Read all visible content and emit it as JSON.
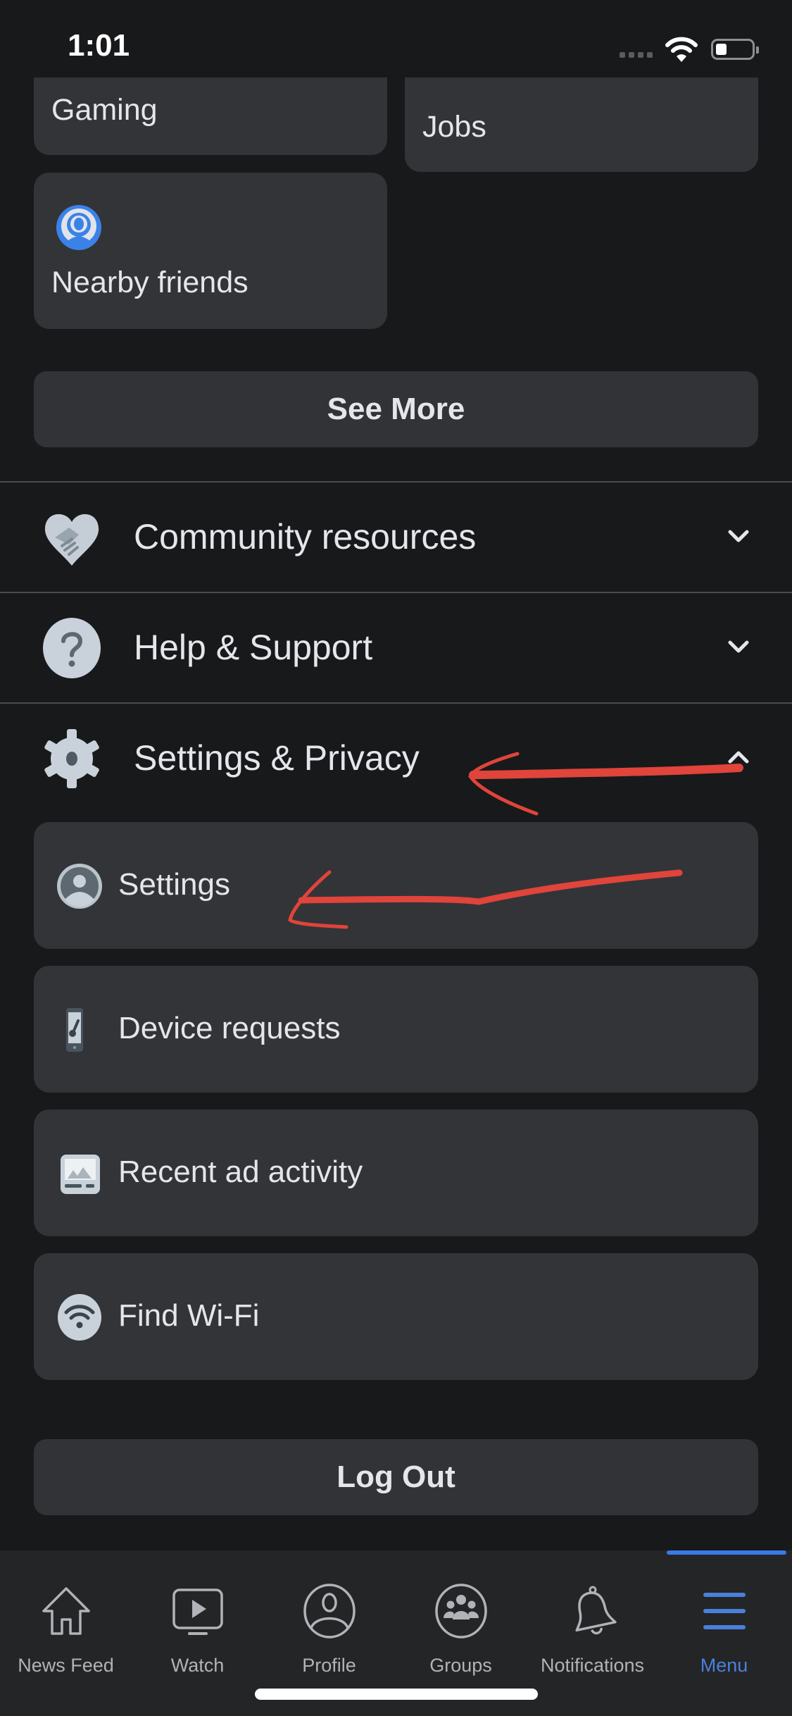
{
  "status_bar": {
    "time": "1:01",
    "battery_level_fraction": 0.3
  },
  "shortcuts": [
    {
      "label": "Gaming"
    },
    {
      "label": "Jobs"
    },
    {
      "label": "Nearby friends",
      "icon": "nearby-friends-icon"
    }
  ],
  "see_more_label": "See More",
  "sections": [
    {
      "label": "Community resources",
      "icon": "handshake-heart-icon",
      "expanded": false
    },
    {
      "label": "Help & Support",
      "icon": "question-icon",
      "expanded": false
    },
    {
      "label": "Settings & Privacy",
      "icon": "gear-icon",
      "expanded": true
    }
  ],
  "settings_items": [
    {
      "label": "Settings",
      "icon": "user-circle-icon"
    },
    {
      "label": "Device requests",
      "icon": "phone-key-icon"
    },
    {
      "label": "Recent ad activity",
      "icon": "ad-image-icon"
    },
    {
      "label": "Find Wi-Fi",
      "icon": "wifi-icon"
    }
  ],
  "log_out_label": "Log Out",
  "tabs": [
    {
      "label": "News Feed",
      "icon": "home-icon",
      "active": false
    },
    {
      "label": "Watch",
      "icon": "watch-video-icon",
      "active": false
    },
    {
      "label": "Profile",
      "icon": "profile-icon",
      "active": false
    },
    {
      "label": "Groups",
      "icon": "groups-icon",
      "active": false
    },
    {
      "label": "Notifications",
      "icon": "bell-icon",
      "active": false
    },
    {
      "label": "Menu",
      "icon": "menu-icon",
      "active": true
    }
  ],
  "colors": {
    "background": "#18191b",
    "card": "#333437",
    "text": "#e4e6eb",
    "accent": "#3a7ae8",
    "annotation": "#e0443a"
  }
}
